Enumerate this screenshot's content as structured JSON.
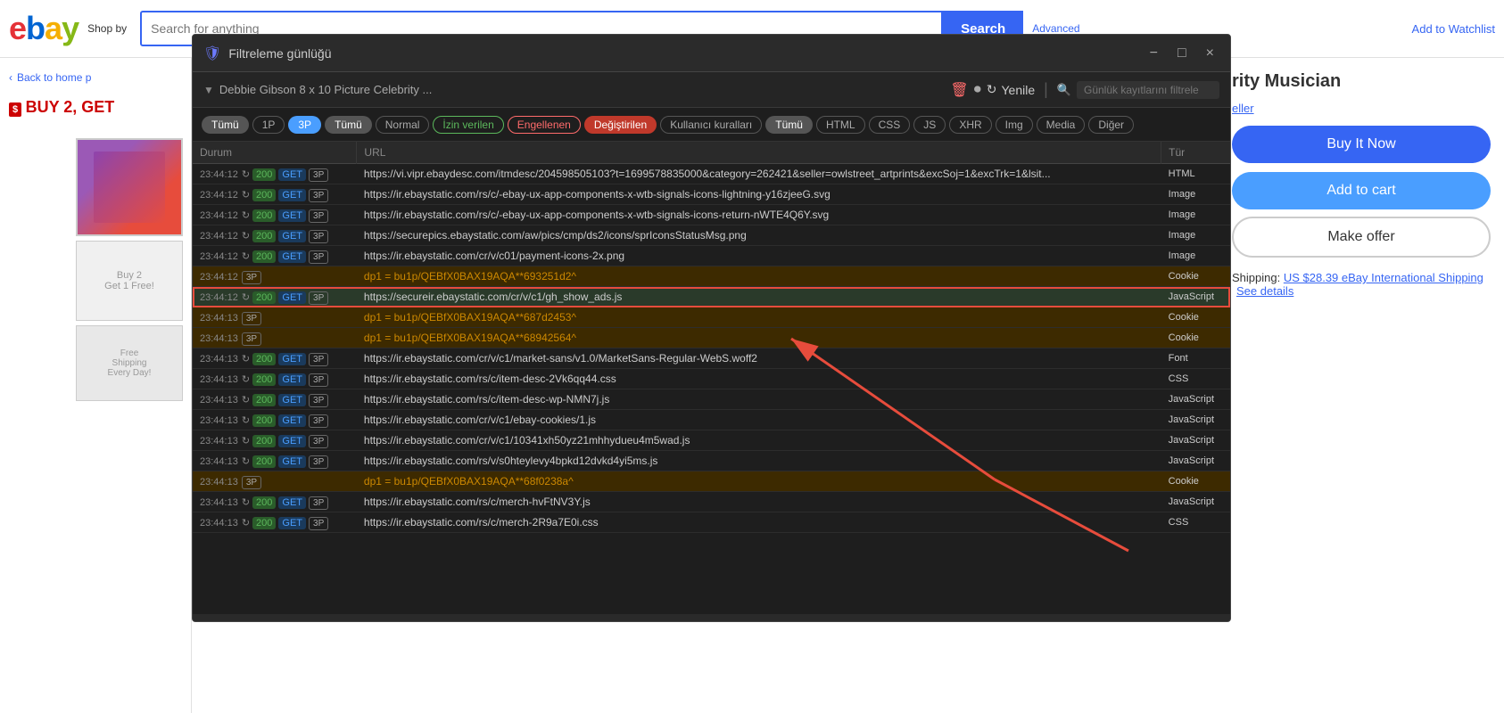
{
  "ebay": {
    "logo_letters": [
      "e",
      "b",
      "a",
      "y"
    ],
    "shop_by": "Shop by",
    "search_placeholder": "Search for anything",
    "search_btn": "Search",
    "advanced_link": "Advanced",
    "back_home": "Back to home p",
    "buy_text": "BUY 2, GET",
    "add_watchlist": "Add to Watchlist",
    "product_title": "rity Musician",
    "seller_label": "eller",
    "shipping_label": "Shipping:",
    "shipping_value": "US $28.39 eBay International Shipping",
    "see_details": "See details"
  },
  "filter_panel": {
    "title": "Filtreleme günlüğü",
    "minimize": "−",
    "maximize": "□",
    "close": "×",
    "breadcrumb_text": "Debbie Gibson 8 x 10 Picture Celebrity ...",
    "refresh_btn": "Yenile",
    "filter_search_placeholder": "Günlük kayıtlarını filtrele",
    "tags": [
      {
        "label": "Tümü",
        "class": "tag-tumu",
        "key": "tag_tumu1"
      },
      {
        "label": "1P",
        "class": "tag-1p",
        "key": "tag_1p"
      },
      {
        "label": "3P",
        "class": "tag-3p-active",
        "key": "tag_3p"
      },
      {
        "label": "Tümü",
        "class": "tag-tumu2",
        "key": "tag_tumu2"
      },
      {
        "label": "Normal",
        "class": "tag-normal",
        "key": "tag_normal"
      },
      {
        "label": "İzin verilen",
        "class": "tag-izin",
        "key": "tag_izin"
      },
      {
        "label": "Engellenen",
        "class": "tag-engellenen",
        "key": "tag_engellenen"
      },
      {
        "label": "Değiştirilen",
        "class": "tag-degistirilen",
        "key": "tag_degistirilen"
      },
      {
        "label": "Kullanıcı kuralları",
        "class": "tag-kullanici",
        "key": "tag_kullanici"
      },
      {
        "label": "Tümü",
        "class": "tag-tumu3",
        "key": "tag_tumu3"
      },
      {
        "label": "HTML",
        "class": "tag-html",
        "key": "tag_html"
      },
      {
        "label": "CSS",
        "class": "tag-css",
        "key": "tag_css"
      },
      {
        "label": "JS",
        "class": "tag-js",
        "key": "tag_js"
      },
      {
        "label": "XHR",
        "class": "tag-xhr",
        "key": "tag_xhr"
      },
      {
        "label": "Img",
        "class": "tag-img",
        "key": "tag_img"
      },
      {
        "label": "Media",
        "class": "tag-media",
        "key": "tag_media"
      },
      {
        "label": "Diğer",
        "class": "tag-diger",
        "key": "tag_diger"
      }
    ],
    "col_durum": "Durum",
    "col_url": "URL",
    "col_tur": "Tür",
    "rows": [
      {
        "time": "23:44:12",
        "status": "200",
        "method": "GET",
        "party": "3P",
        "url": "https://vi.vipr.ebaydesc.com/itmdesc/204598505103?t=1699578835000&category=262421&seller=owlstreet_artprints&excSoj=1&excTrk=1&lsit...",
        "type": "HTML",
        "row_class": "row-normal"
      },
      {
        "time": "23:44:12",
        "status": "200",
        "method": "GET",
        "party": "3P",
        "url": "https://ir.ebaystatic.com/rs/c/-ebay-ux-app-components-x-wtb-signals-icons-lightning-y16zjeeG.svg",
        "type": "Image",
        "row_class": "row-normal"
      },
      {
        "time": "23:44:12",
        "status": "200",
        "method": "GET",
        "party": "3P",
        "url": "https://ir.ebaystatic.com/rs/c/-ebay-ux-app-components-x-wtb-signals-icons-return-nWTE4Q6Y.svg",
        "type": "Image",
        "row_class": "row-normal"
      },
      {
        "time": "23:44:12",
        "status": "200",
        "method": "GET",
        "party": "3P",
        "url": "https://securepics.ebaystatic.com/aw/pics/cmp/ds2/icons/sprIconsStatusMsg.png",
        "type": "Image",
        "row_class": "row-normal"
      },
      {
        "time": "23:44:12",
        "status": "200",
        "method": "GET",
        "party": "3P",
        "url": "https://ir.ebaystatic.com/cr/v/c01/payment-icons-2x.png",
        "type": "Image",
        "row_class": "row-normal"
      },
      {
        "time": "23:44:12",
        "status": "",
        "method": "",
        "party": "3P",
        "url": "dp1 = bu1p/QEBfX0BAX19AQA**693251d2^",
        "type": "Cookie",
        "row_class": "row-cookie"
      },
      {
        "time": "23:44:12",
        "status": "200",
        "method": "GET",
        "party": "3P",
        "url": "https://secureir.ebaystatic.com/cr/v/c1/gh_show_ads.js",
        "type": "JavaScript",
        "row_class": "row-selected"
      },
      {
        "time": "23:44:13",
        "status": "",
        "method": "",
        "party": "3P",
        "url": "dp1 = bu1p/QEBfX0BAX19AQA**687d2453^",
        "type": "Cookie",
        "row_class": "row-cookie"
      },
      {
        "time": "23:44:13",
        "status": "",
        "method": "",
        "party": "3P",
        "url": "dp1 = bu1p/QEBfX0BAX19AQA**68942564^",
        "type": "Cookie",
        "row_class": "row-cookie"
      },
      {
        "time": "23:44:13",
        "status": "200",
        "method": "GET",
        "party": "3P",
        "url": "https://ir.ebaystatic.com/cr/v/c1/market-sans/v1.0/MarketSans-Regular-WebS.woff2",
        "type": "Font",
        "row_class": "row-normal"
      },
      {
        "time": "23:44:13",
        "status": "200",
        "method": "GET",
        "party": "3P",
        "url": "https://ir.ebaystatic.com/rs/c/item-desc-2Vk6qq44.css",
        "type": "CSS",
        "row_class": "row-normal"
      },
      {
        "time": "23:44:13",
        "status": "200",
        "method": "GET",
        "party": "3P",
        "url": "https://ir.ebaystatic.com/rs/c/item-desc-wp-NMN7j.js",
        "type": "JavaScript",
        "row_class": "row-normal"
      },
      {
        "time": "23:44:13",
        "status": "200",
        "method": "GET",
        "party": "3P",
        "url": "https://ir.ebaystatic.com/cr/v/c1/ebay-cookies/1.js",
        "type": "JavaScript",
        "row_class": "row-normal"
      },
      {
        "time": "23:44:13",
        "status": "200",
        "method": "GET",
        "party": "3P",
        "url": "https://ir.ebaystatic.com/cr/v/c1/10341xh50yz21mhhydueu4m5wad.js",
        "type": "JavaScript",
        "row_class": "row-normal"
      },
      {
        "time": "23:44:13",
        "status": "200",
        "method": "GET",
        "party": "3P",
        "url": "https://ir.ebaystatic.com/rs/v/s0hteylevy4bpkd12dvkd4yi5ms.js",
        "type": "JavaScript",
        "row_class": "row-normal"
      },
      {
        "time": "23:44:13",
        "status": "",
        "method": "",
        "party": "3P",
        "url": "dp1 = bu1p/QEBfX0BAX19AQA**68f0238a^",
        "type": "Cookie",
        "row_class": "row-cookie"
      },
      {
        "time": "23:44:13",
        "status": "200",
        "method": "GET",
        "party": "3P",
        "url": "https://ir.ebaystatic.com/rs/c/merch-hvFtNV3Y.js",
        "type": "JavaScript",
        "row_class": "row-normal"
      },
      {
        "time": "23:44:13",
        "status": "200",
        "method": "GET",
        "party": "3P",
        "url": "https://ir.ebaystatic.com/rs/c/merch-2R9a7E0i.css",
        "type": "CSS",
        "row_class": "row-normal"
      }
    ]
  }
}
